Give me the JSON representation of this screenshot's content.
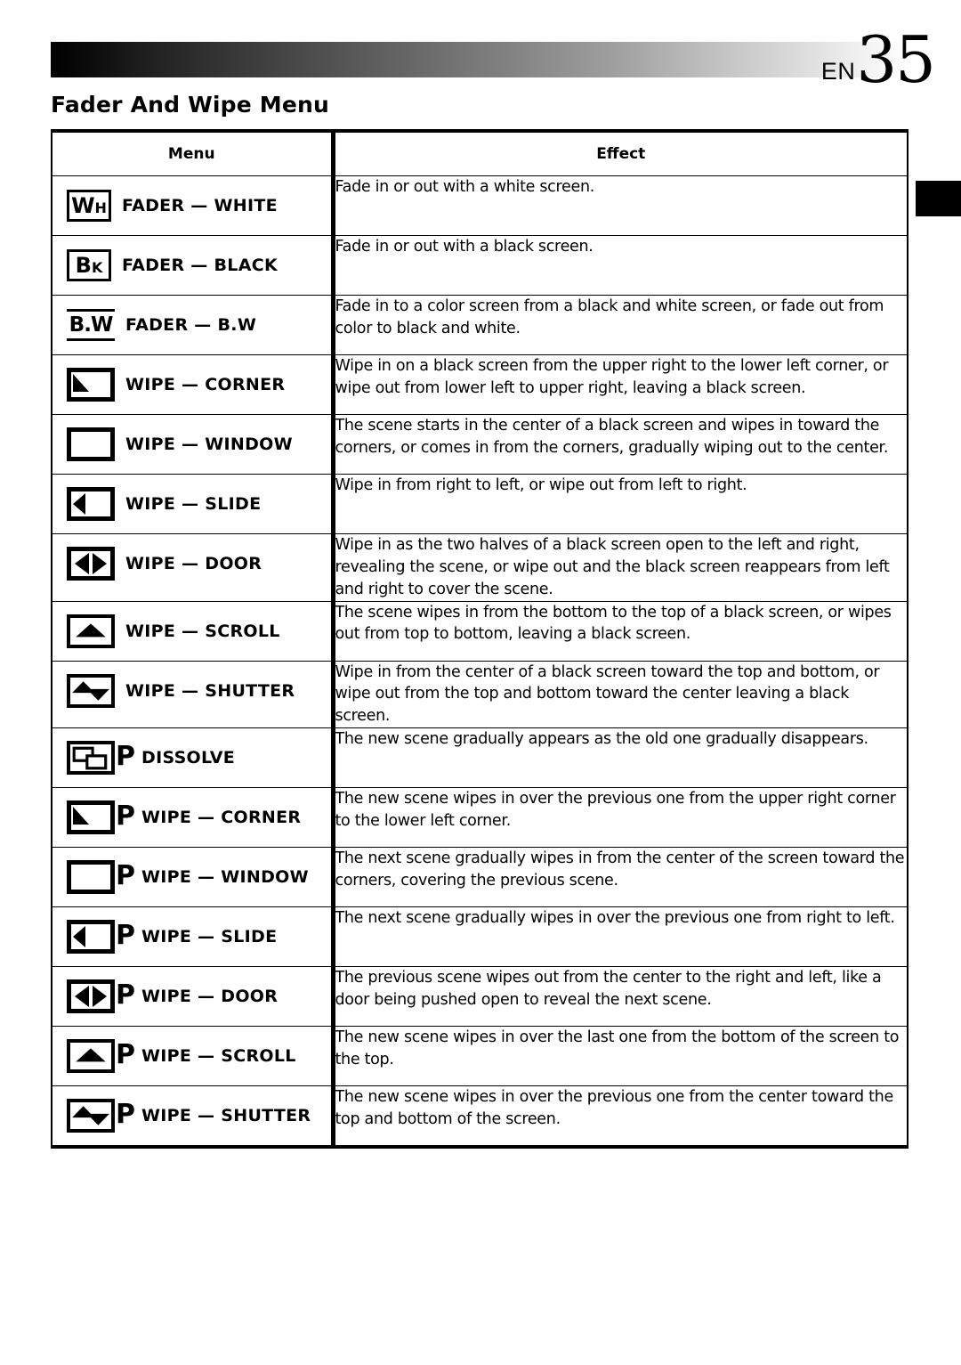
{
  "page": {
    "locale_code": "EN",
    "page_number": "35",
    "section_title": "Fader And Wipe Menu"
  },
  "table": {
    "headers": {
      "menu": "Menu",
      "effect": "Effect"
    },
    "rows": [
      {
        "icon": "fader-white-icon",
        "icon_kind": "textbox",
        "icon_text_main": "W",
        "icon_text_sub": "H",
        "prefix": "",
        "label": "FADER — WHITE",
        "effect": "Fade in or out with a white screen."
      },
      {
        "icon": "fader-black-icon",
        "icon_kind": "textbox",
        "icon_text_main": "B",
        "icon_text_sub": "K",
        "prefix": "",
        "label": "FADER — BLACK",
        "effect": "Fade in or out with a black screen."
      },
      {
        "icon": "fader-bw-icon",
        "icon_kind": "bw",
        "icon_text_main": "B.W",
        "icon_text_sub": "",
        "prefix": "",
        "label": "FADER — B.W",
        "effect": "Fade in to a color screen from a black and white screen, or fade out from color to black and white."
      },
      {
        "icon": "wipe-corner-icon",
        "icon_kind": "corner",
        "prefix": "",
        "label": "WIPE — CORNER",
        "effect": "Wipe in on a black screen from the upper right to the lower left corner, or wipe out from lower left to upper right, leaving a black screen."
      },
      {
        "icon": "wipe-window-icon",
        "icon_kind": "window",
        "prefix": "",
        "label": "WIPE — WINDOW",
        "effect": "The scene starts in the center of a black screen and wipes in toward the corners, or comes in from the corners, gradually wiping out to the center."
      },
      {
        "icon": "wipe-slide-icon",
        "icon_kind": "slide",
        "prefix": "",
        "label": "WIPE — SLIDE",
        "effect": "Wipe in from right to left, or wipe out from left to right."
      },
      {
        "icon": "wipe-door-icon",
        "icon_kind": "door",
        "prefix": "",
        "label": "WIPE — DOOR",
        "effect": "Wipe in as the two halves of a black screen open to the left and right, revealing the scene, or wipe out and the black screen reappears from left and right to cover the scene."
      },
      {
        "icon": "wipe-scroll-icon",
        "icon_kind": "scroll",
        "prefix": "",
        "label": "WIPE — SCROLL",
        "effect": "The scene wipes in from the bottom to the top of a black screen, or wipes out from top to bottom, leaving a black screen."
      },
      {
        "icon": "wipe-shutter-icon",
        "icon_kind": "shutter",
        "prefix": "",
        "label": "WIPE — SHUTTER",
        "effect": "Wipe in from the center of a black screen toward the top and bottom, or wipe out from the top and bottom toward the center leaving a black screen."
      },
      {
        "icon": "dissolve-icon",
        "icon_kind": "dissolve",
        "prefix": "P",
        "label": "DISSOLVE",
        "effect": "The new scene gradually appears as the old one gradually disappears."
      },
      {
        "icon": "wipe-corner-p-icon",
        "icon_kind": "corner",
        "prefix": "P",
        "label": "WIPE — CORNER",
        "effect": "The new scene wipes in over the previous one from the upper right corner to the lower left corner."
      },
      {
        "icon": "wipe-window-p-icon",
        "icon_kind": "window",
        "prefix": "P",
        "label": "WIPE — WINDOW",
        "effect": "The next scene gradually wipes in from the center of the screen toward the corners, covering the previous scene."
      },
      {
        "icon": "wipe-slide-p-icon",
        "icon_kind": "slide",
        "prefix": "P",
        "label": "WIPE — SLIDE",
        "effect": "The next scene gradually wipes in over the previous one from right to left."
      },
      {
        "icon": "wipe-door-p-icon",
        "icon_kind": "door",
        "prefix": "P",
        "label": "WIPE — DOOR",
        "effect": "The previous scene wipes out from the center to the right and left, like a door being pushed open to reveal the next scene."
      },
      {
        "icon": "wipe-scroll-p-icon",
        "icon_kind": "scroll",
        "prefix": "P",
        "label": "WIPE — SCROLL",
        "effect": "The new scene wipes in over the last one from the bottom of the screen to the top."
      },
      {
        "icon": "wipe-shutter-p-icon",
        "icon_kind": "shutter",
        "prefix": "P",
        "label": "WIPE — SHUTTER",
        "effect": "The new scene wipes in over the previous one from the center toward the top and bottom of the screen."
      }
    ]
  }
}
